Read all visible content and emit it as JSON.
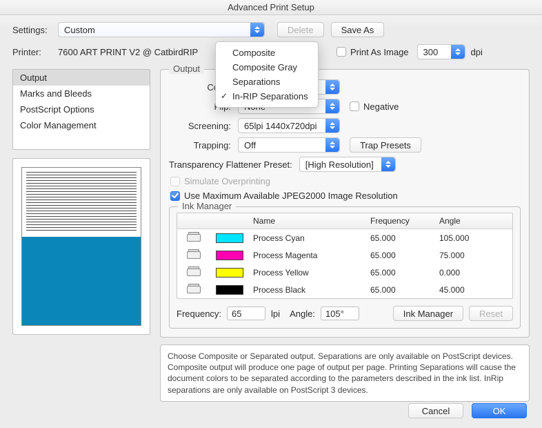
{
  "title": "Advanced Print Setup",
  "topbar": {
    "settings_label": "Settings:",
    "settings_value": "Custom",
    "delete": "Delete",
    "save_as": "Save As",
    "printer_label": "Printer:",
    "printer_value": "7600 ART PRINT V2 @ CatbirdRIP",
    "print_as_image": "Print As Image",
    "dpi_value": "300",
    "dpi_unit": "dpi"
  },
  "dropdown": {
    "options": [
      "Composite",
      "Composite Gray",
      "Separations",
      "In-RIP Separations"
    ],
    "selected_index": 3
  },
  "sidebar": {
    "items": [
      "Output",
      "Marks and Bleeds",
      "PostScript Options",
      "Color Management"
    ],
    "selected_index": 0
  },
  "output": {
    "legend": "Output",
    "color_label": "Color:",
    "flip_label": "Flip:",
    "flip_value": "None",
    "negative_label": "Negative",
    "screening_label": "Screening:",
    "screening_value": "65lpi 1440x720dpi",
    "trapping_label": "Trapping:",
    "trapping_value": "Off",
    "trap_presets": "Trap Presets",
    "trans_label": "Transparency Flattener Preset:",
    "trans_value": "[High Resolution]",
    "sim_overprint": "Simulate Overprinting",
    "jpeg2000": "Use Maximum Available JPEG2000 Image Resolution"
  },
  "ink": {
    "legend": "Ink Manager",
    "headers": {
      "name": "Name",
      "freq": "Frequency",
      "angle": "Angle"
    },
    "rows": [
      {
        "color": "#00e5ff",
        "name": "Process Cyan",
        "freq": "65.000",
        "angle": "105.000"
      },
      {
        "color": "#ff00b3",
        "name": "Process Magenta",
        "freq": "65.000",
        "angle": "75.000"
      },
      {
        "color": "#ffff00",
        "name": "Process Yellow",
        "freq": "65.000",
        "angle": "0.000"
      },
      {
        "color": "#000000",
        "name": "Process Black",
        "freq": "65.000",
        "angle": "45.000"
      }
    ],
    "freq_label": "Frequency:",
    "freq_value": "65",
    "lpi": "lpi",
    "angle_label": "Angle:",
    "angle_value": "105°",
    "ink_mgr_btn": "Ink Manager",
    "reset_btn": "Reset"
  },
  "help": "Choose Composite or Separated output. Separations are only available on PostScript devices. Composite output will produce one page of output per page. Printing Separations will cause the document colors to be separated according to the parameters described in the ink list. InRip separations are only available on PostScript 3 devices.",
  "footer": {
    "cancel": "Cancel",
    "ok": "OK"
  }
}
